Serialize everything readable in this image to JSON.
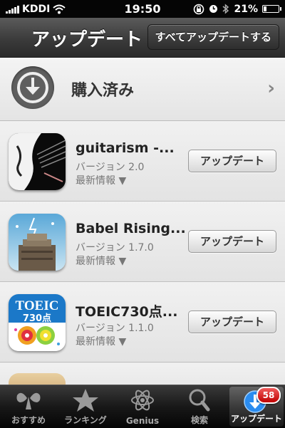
{
  "status_bar": {
    "carrier": "KDDI",
    "time": "19:50",
    "battery": "21%",
    "battery_level": 0.21
  },
  "nav": {
    "title": "アップデート",
    "update_all_label": "すべてアップデートする"
  },
  "purchased": {
    "label": "購入済み"
  },
  "apps": [
    {
      "name": "guitarism -...",
      "version": "バージョン 2.0",
      "info": "最新情報 ▼",
      "button": "アップデート"
    },
    {
      "name": "Babel Rising...",
      "version": "バージョン 1.7.0",
      "info": "最新情報 ▼",
      "button": "アップデート"
    },
    {
      "name": "TOEIC730点...",
      "version": "バージョン 1.1.0",
      "info": "最新情報 ▼",
      "button": "アップデート",
      "icon_text": [
        "TOEIC",
        "730点"
      ]
    }
  ],
  "tabs": [
    {
      "label": "おすすめ",
      "icon": "featured-icon"
    },
    {
      "label": "ランキング",
      "icon": "star-icon"
    },
    {
      "label": "Genius",
      "icon": "atom-icon"
    },
    {
      "label": "検索",
      "icon": "search-icon"
    },
    {
      "label": "アップデート",
      "icon": "download-icon",
      "badge": "58",
      "active": true
    }
  ],
  "colors": {
    "badge": "#d01010",
    "active_tab_icon": "#2a8cf0"
  }
}
